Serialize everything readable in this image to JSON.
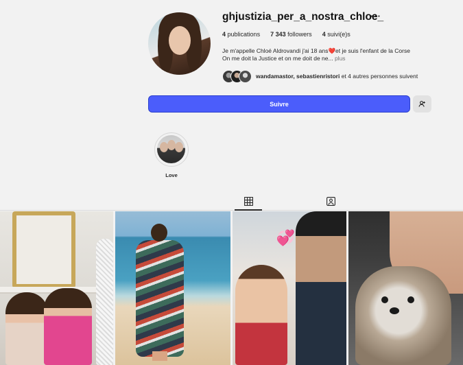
{
  "profile": {
    "username": "ghjustizia_per_a_nostra_chloe_",
    "more_label": "···",
    "stats": {
      "publications_count": "4",
      "publications_label": "publications",
      "followers_count": "7 343",
      "followers_label": "followers",
      "following_count": "4",
      "following_label": "suivi(e)s"
    },
    "bio": {
      "line1_a": "Je m'appelle Chloé Aldrovandi j'ai 18 ans",
      "line1_heart": "❤️",
      "line1_b": "et je suis l'enfant de la Corse",
      "line2": "On me doit la Justice et on me doit de ne...",
      "more": " plus"
    },
    "followed_by": {
      "names": "wandamastor, sebastienristori",
      "rest": " et 4 autres personnes suivent"
    }
  },
  "actions": {
    "follow_label": "Suivre",
    "suggest_icon": "person-add-icon"
  },
  "highlights": [
    {
      "label": "Love"
    }
  ],
  "tabs": [
    {
      "name": "posts",
      "icon": "grid-icon",
      "active": true
    },
    {
      "name": "tagged",
      "icon": "tagged-icon",
      "active": false
    }
  ],
  "posts": [
    {
      "description_icon": "photo"
    },
    {
      "description_icon": "photo"
    },
    {
      "description_icon": "photo"
    },
    {
      "description_icon": "photo"
    }
  ],
  "colors": {
    "follow_button": "#4b5dfb",
    "background": "#f2f2f2",
    "heart": "#e0243f"
  }
}
